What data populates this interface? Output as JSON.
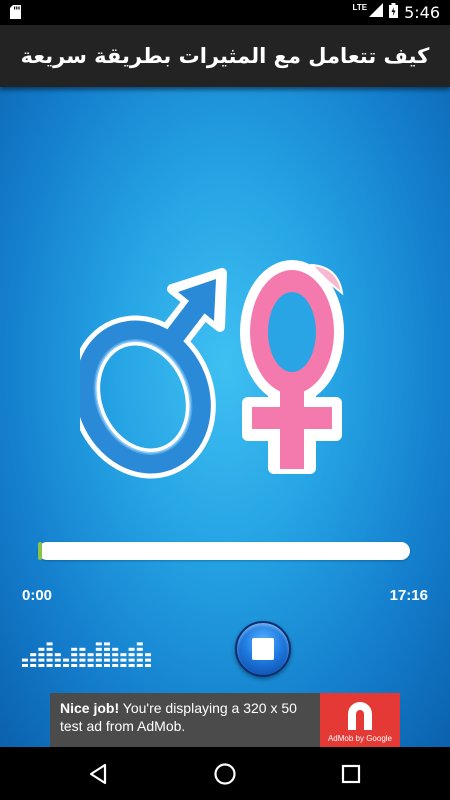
{
  "status_bar": {
    "network": "LTE",
    "time": "5:46"
  },
  "title": "كيف تتعامل مع المثيرات بطريقة سريعة",
  "player": {
    "progress_fraction": 0.0,
    "current_time": "0:00",
    "total_time": "17:16"
  },
  "ad": {
    "headline": "Nice job!",
    "body": "You're displaying a 320 x 50 test ad from AdMob.",
    "brand": "AdMob by Google"
  },
  "colors": {
    "title_bar": "#232323",
    "background_blue": "#25a3e4",
    "male_symbol": "#2a8ad8",
    "female_symbol": "#f47aae",
    "ad_red": "#e53935"
  },
  "icons": {
    "male": "male-symbol-icon",
    "female": "female-symbol-icon",
    "stop": "stop-icon",
    "back": "back-triangle-icon",
    "home": "home-circle-icon",
    "recent": "recent-square-icon"
  }
}
